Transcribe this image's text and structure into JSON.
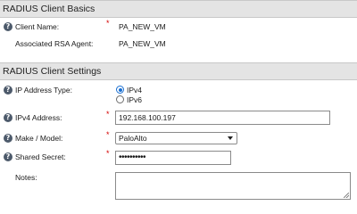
{
  "basics": {
    "title": "RADIUS Client Basics",
    "client_name_label": "Client Name:",
    "client_name_value": "PA_NEW_VM",
    "agent_label": "Associated RSA Agent:",
    "agent_value": "PA_NEW_VM"
  },
  "settings": {
    "title": "RADIUS Client Settings",
    "ip_type_label": "IP Address Type:",
    "ip_type_options": [
      "IPv4",
      "IPv6"
    ],
    "ip_type_selected": "IPv4",
    "ipv4_label": "IPv4 Address:",
    "ipv4_value": "192.168.100.197",
    "make_label": "Make / Model:",
    "make_value": "PaloAlto",
    "secret_label": "Shared Secret:",
    "secret_value": "••••••••••",
    "notes_label": "Notes:",
    "notes_value": ""
  },
  "icons": {
    "help": "?",
    "required": "*"
  }
}
